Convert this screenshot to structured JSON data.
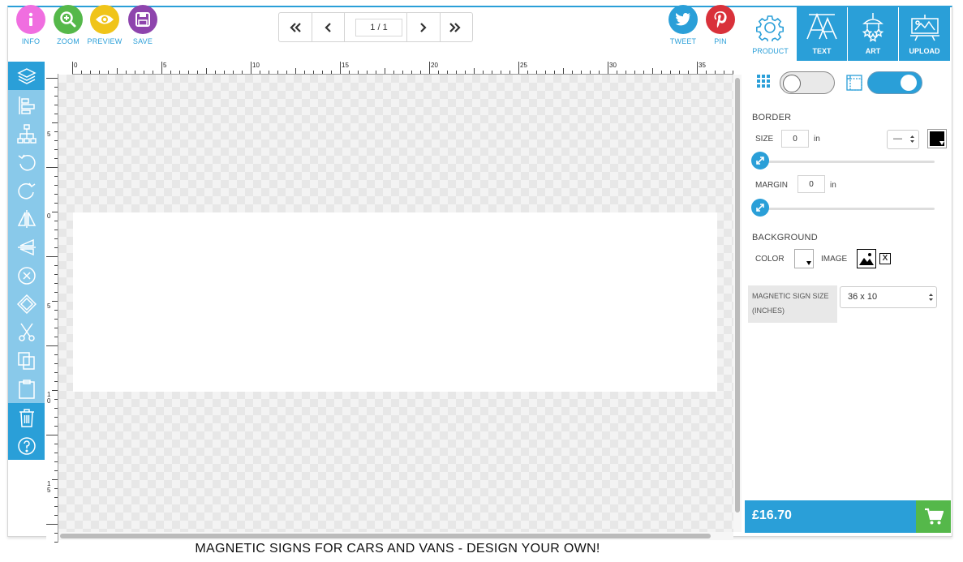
{
  "toolbar": {
    "info": {
      "label": "INFO",
      "color": "#f06ee0"
    },
    "zoom": {
      "label": "ZOOM",
      "color": "#55b84a"
    },
    "preview": {
      "label": "PREVIEW",
      "color": "#f0c419"
    },
    "save": {
      "label": "SAVE",
      "color": "#8e44ad"
    },
    "tweet": {
      "label": "TWEET",
      "color": "#2a9fd8"
    },
    "pin": {
      "label": "PIN",
      "color": "#d9313a"
    }
  },
  "pager": {
    "page_indicator": "1 / 1"
  },
  "right_tabs": [
    {
      "label": "PRODUCT",
      "icon": "gear-icon",
      "active": true
    },
    {
      "label": "TEXT",
      "icon": "text-icon",
      "active": false
    },
    {
      "label": "ART",
      "icon": "art-icon",
      "active": false
    },
    {
      "label": "UPLOAD",
      "icon": "upload-icon",
      "active": false
    }
  ],
  "ruler": {
    "horizontal": [
      "0",
      "5",
      "10",
      "15",
      "20",
      "25",
      "30",
      "35"
    ],
    "vertical": [
      "5",
      "0",
      "5",
      "1\n0",
      "1\n5"
    ]
  },
  "product_panel": {
    "grid_toggle": {
      "on": false
    },
    "bleed_toggle": {
      "on": true
    },
    "border": {
      "heading": "BORDER",
      "size_label": "SIZE",
      "size_value": "0",
      "size_unit": "in",
      "style_value": "—",
      "color": "#000000",
      "margin_label": "MARGIN",
      "margin_value": "0",
      "margin_unit": "in"
    },
    "background": {
      "heading": "BACKGROUND",
      "color_label": "COLOR",
      "image_label": "IMAGE",
      "remove_symbol": "X"
    },
    "sign_size": {
      "label_line1": "MAGNETIC SIGN SIZE",
      "label_line2": "(INCHES)",
      "value": "36 x 10"
    }
  },
  "price": {
    "value": "£16.70"
  },
  "footer": {
    "title": "MAGNETIC SIGNS FOR CARS AND VANS - DESIGN YOUR OWN!"
  },
  "colors": {
    "accent": "#2a9fd8",
    "tools_bg": "#89c9ea",
    "cart_green": "#55b84a"
  }
}
